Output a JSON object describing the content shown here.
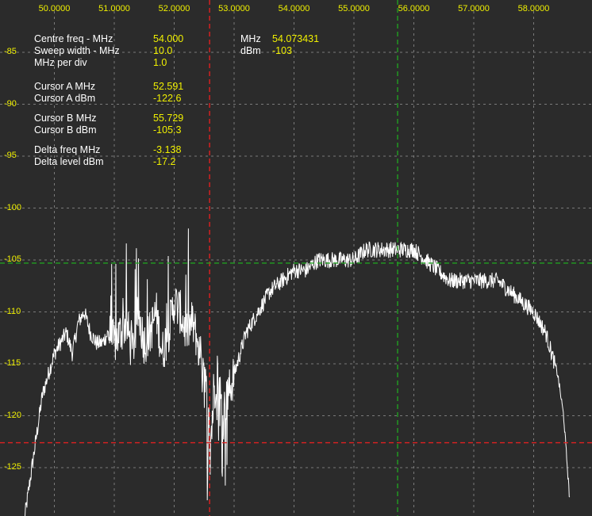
{
  "colors": {
    "background": "#2b2b2b",
    "grid": "#7a7a7a",
    "axis_label": "#f0f000",
    "info_label": "#ffffff",
    "info_value": "#f0f000",
    "trace": "#ffffff",
    "cursor_a": "#e02020",
    "cursor_b": "#20a020"
  },
  "info": [
    {
      "label": "Centre freq - MHz",
      "value": "54.000"
    },
    {
      "label": "Sweep width - MHz",
      "value": "10.0"
    },
    {
      "label": "MHz per div",
      "value": "1.0"
    },
    {
      "label": "Cursor A MHz",
      "value": "52.591"
    },
    {
      "label": "Cursor A dBm",
      "value": "-122.6"
    },
    {
      "label": "Cursor B MHz",
      "value": "55.729"
    },
    {
      "label": "Cursor B dBm",
      "value": "-105.3"
    },
    {
      "label": "Delta freq MHz",
      "value": "-3.138"
    },
    {
      "label": "Delta level dBm",
      "value": "-17.2"
    }
  ],
  "marker": [
    {
      "label": "MHz",
      "value": "54.073431"
    },
    {
      "label": "dBm",
      "value": "-103"
    }
  ],
  "chart_data": {
    "type": "line",
    "title": "",
    "xlabel": "",
    "ylabel": "",
    "x_ticks": [
      "50.0000",
      "51.0000",
      "52.0000",
      "53.0000",
      "54.0000",
      "55.0000",
      "56.0000",
      "57.0000",
      "58.0000"
    ],
    "y_ticks": [
      "-85",
      "-90",
      "-95",
      "-100",
      "-105",
      "-110",
      "-115",
      "-120",
      "-125"
    ],
    "xlim": [
      49.0,
      59.0
    ],
    "ylim": [
      -130,
      -80
    ],
    "grid": true,
    "cursors": {
      "a": {
        "freq": 52.591,
        "level": -122.6
      },
      "b": {
        "freq": 55.729,
        "level": -105.3
      }
    },
    "series": [
      {
        "x": [
          49.5,
          49.6,
          49.7,
          49.8,
          49.9,
          50.0,
          50.1,
          50.2,
          50.3,
          50.4,
          50.5,
          50.6,
          50.7,
          50.8,
          50.9,
          51.0,
          51.1,
          51.2,
          51.3,
          51.4,
          51.5,
          51.6,
          51.7,
          51.8,
          51.9,
          52.0,
          52.1,
          52.2,
          52.3,
          52.4,
          52.5,
          52.6,
          52.7,
          52.8,
          52.9,
          53.0,
          53.2,
          53.4,
          53.6,
          53.8,
          54.0,
          54.2,
          54.4,
          54.6,
          54.8,
          55.0,
          55.2,
          55.4,
          55.6,
          55.8,
          56.0,
          56.2,
          56.4,
          56.6,
          56.8,
          57.0,
          57.2,
          57.4,
          57.6,
          57.8,
          58.0,
          58.2,
          58.3,
          58.4,
          58.5,
          58.6
        ],
        "y": [
          -130,
          -126,
          -122,
          -118,
          -116,
          -114,
          -113,
          -112,
          -114,
          -111,
          -110,
          -112,
          -113,
          -113,
          -112,
          -113,
          -112,
          -111,
          -114,
          -110,
          -113,
          -112,
          -110,
          -114,
          -112,
          -109,
          -110,
          -112,
          -111,
          -113,
          -116,
          -123,
          -115,
          -120,
          -118,
          -116,
          -112,
          -110,
          -108,
          -107,
          -106,
          -106,
          -105,
          -105,
          -105,
          -105,
          -104,
          -104,
          -104,
          -104,
          -104,
          -105,
          -106,
          -107,
          -107,
          -107,
          -107,
          -107,
          -108,
          -109,
          -110,
          -112,
          -114,
          -116,
          -120,
          -128
        ]
      }
    ]
  }
}
